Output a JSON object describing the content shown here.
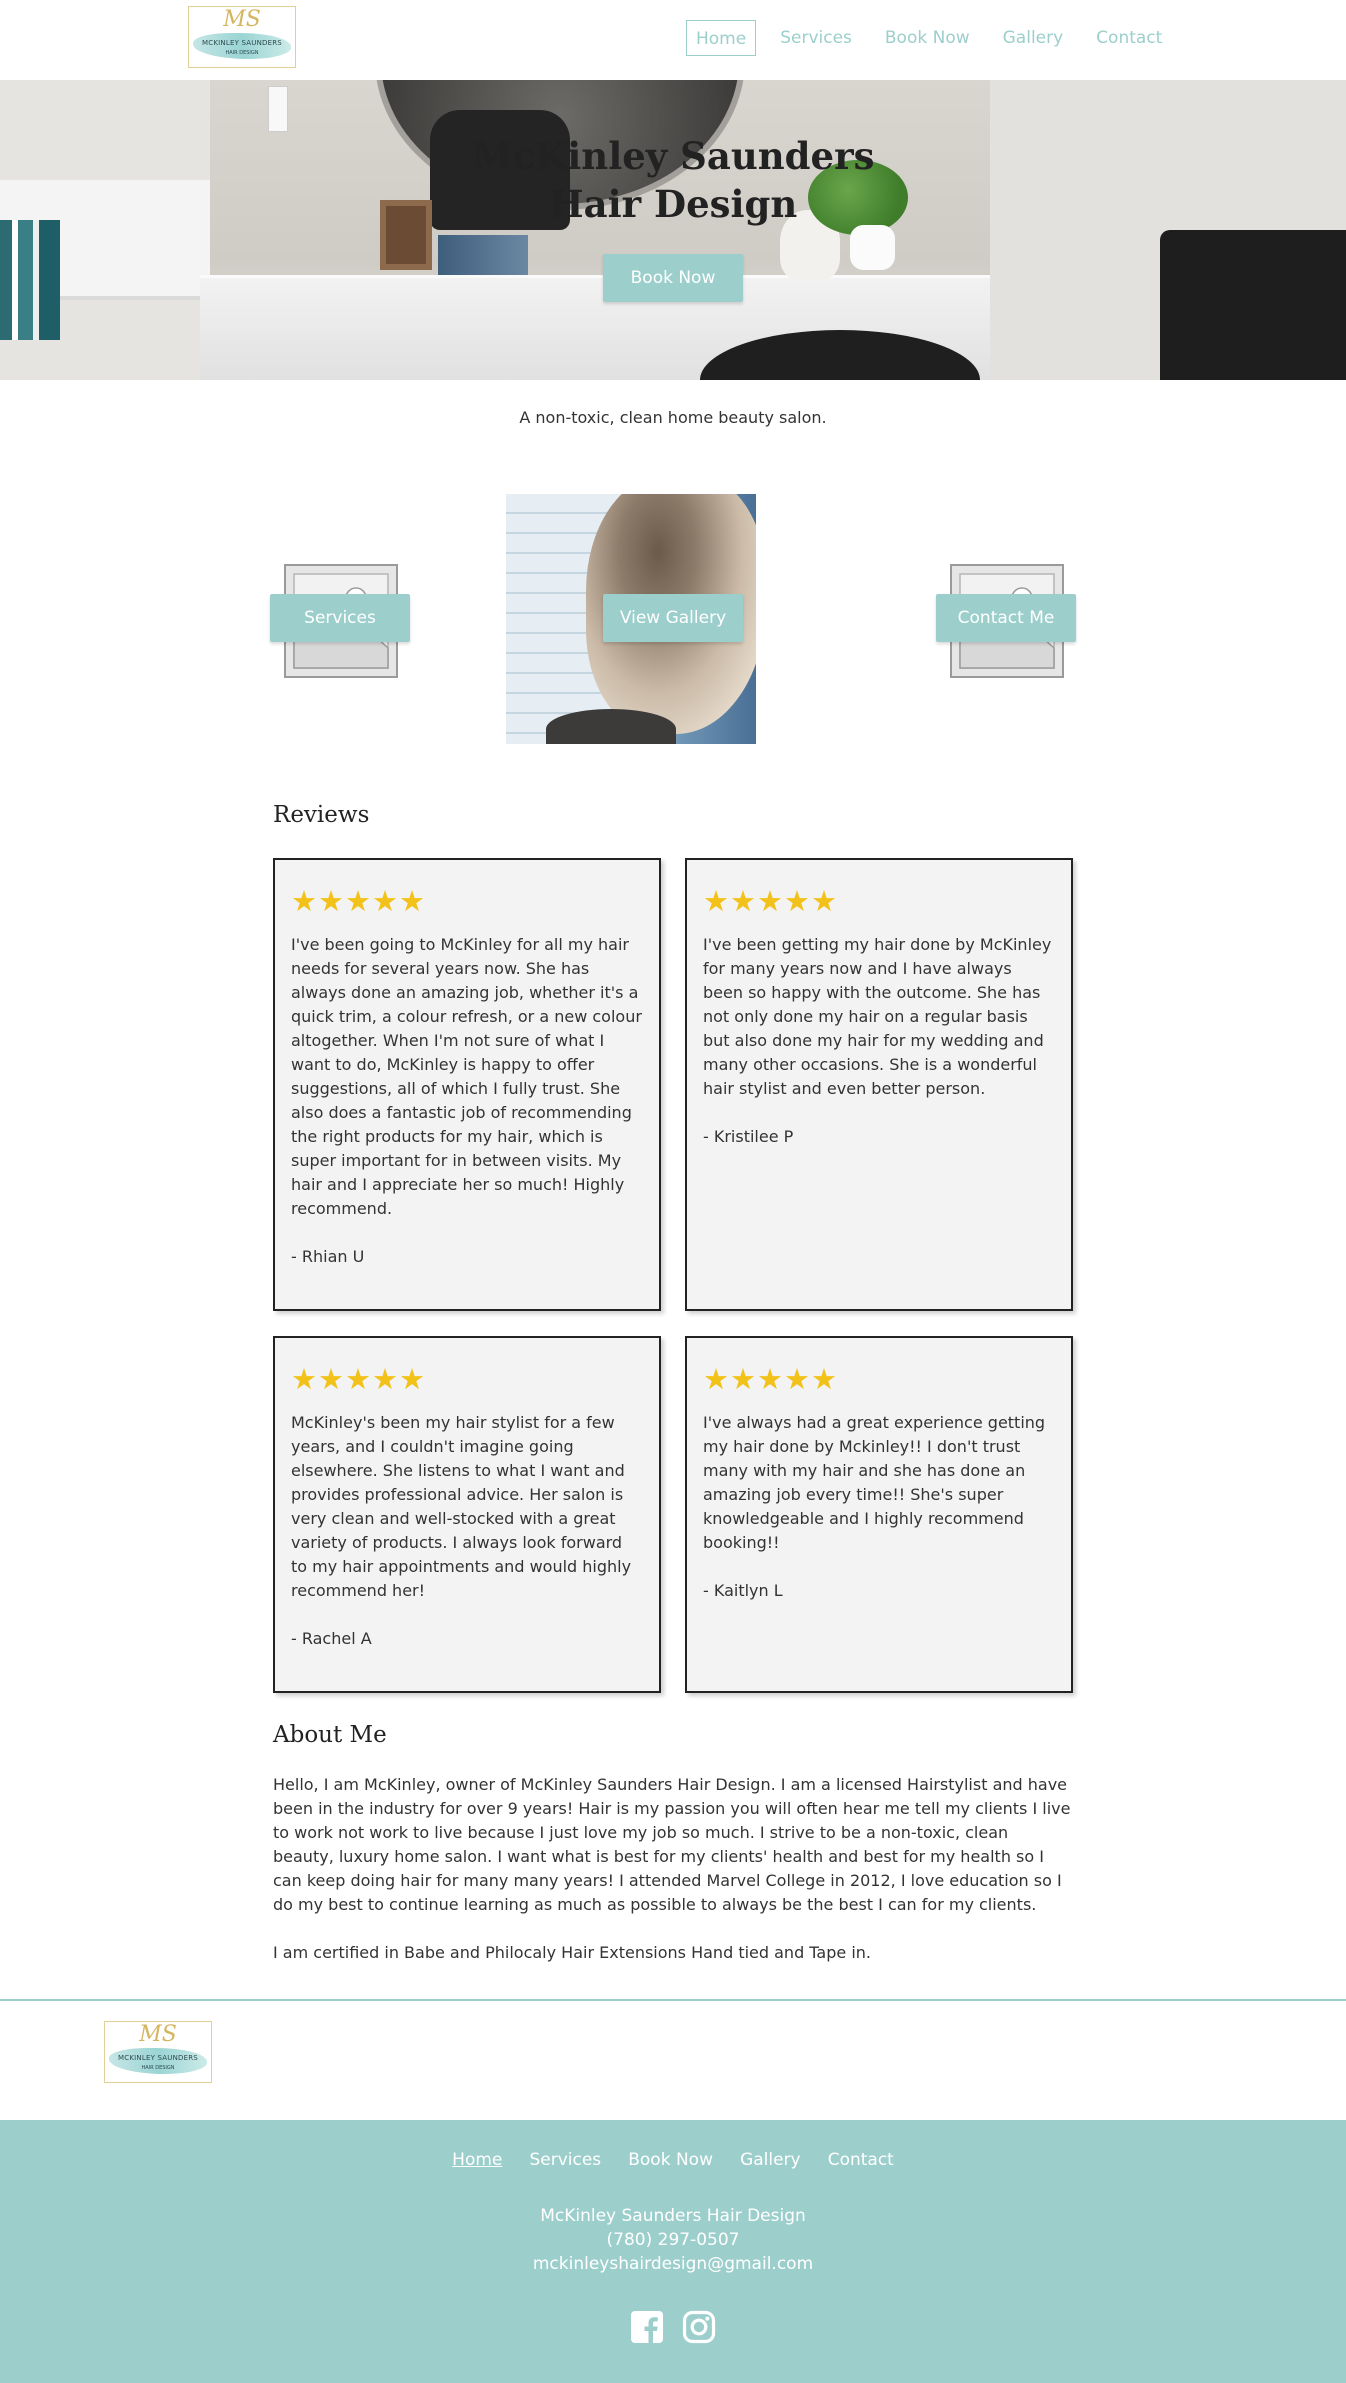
{
  "header": {
    "logo": {
      "monogram": "MS",
      "name": "MCKINLEY SAUNDERS",
      "subtitle": "HAIR DESIGN"
    },
    "nav": [
      {
        "label": "Home",
        "active": true
      },
      {
        "label": "Services",
        "active": false
      },
      {
        "label": "Book Now",
        "active": false
      },
      {
        "label": "Gallery",
        "active": false
      },
      {
        "label": "Contact",
        "active": false
      }
    ]
  },
  "hero": {
    "title_line1": "McKinley Saunders",
    "title_line2": "Hair Design",
    "button": "Book Now"
  },
  "tagline": "A non-toxic, clean home beauty salon.",
  "tiles": {
    "services": "Services",
    "gallery": "View Gallery",
    "contact": "Contact Me"
  },
  "reviews": {
    "heading": "Reviews",
    "stars": "★★★★★",
    "items": [
      {
        "text": "I've been going to McKinley for all my hair needs for several years now. She has always done an amazing job, whether it's a quick trim, a colour refresh, or a new colour altogether. When I'm not sure of what I want to do, McKinley is happy to offer suggestions, all of which I fully trust. She also does a fantastic job of recommending the right products for my hair, which is super important for in between visits. My hair and I appreciate her so much! Highly recommend.",
        "author": "- Rhian U"
      },
      {
        "text": "I've been getting my hair done by McKinley for many years now and I have always been so happy with the outcome. She has not only done my hair on a regular basis but also done my hair for my wedding and many other occasions. She is a wonderful hair stylist and even better person.",
        "author": "- Kristilee P"
      },
      {
        "text": "McKinley's been my hair stylist for a few years, and I couldn't imagine going elsewhere. She listens to what I want and provides professional advice. Her salon is very clean and well-stocked with a great variety of products. I always look forward to my hair appointments and would highly recommend her!",
        "author": "- Rachel A"
      },
      {
        "text": "I've always had a great experience getting my hair done by Mckinley!! I don't trust many with my hair and she has done an amazing job every time!! She's super knowledgeable and I highly recommend booking!!",
        "author": "- Kaitlyn L"
      }
    ]
  },
  "about": {
    "heading": "About Me",
    "paragraph1": "Hello, I am McKinley, owner of McKinley Saunders Hair Design. I am a licensed Hairstylist and have been in the industry for over 9 years! Hair is my passion you will often hear me tell my clients I live to work not work to live because I just love my job so much. I strive to be a non-toxic, clean beauty, luxury home salon. I want what is best for my clients' health and best for my health so I can keep doing hair for many many years! I attended Marvel College in 2012, I love education so I do my best to continue learning as much as possible to always be the best I can for my clients.",
    "paragraph2": "I am certified in Babe and Philocaly Hair Extensions Hand tied and Tape in."
  },
  "footer": {
    "nav": [
      {
        "label": "Home",
        "active": true
      },
      {
        "label": "Services",
        "active": false
      },
      {
        "label": "Book Now",
        "active": false
      },
      {
        "label": "Gallery",
        "active": false
      },
      {
        "label": "Contact",
        "active": false
      }
    ],
    "business_name": "McKinley Saunders Hair Design",
    "phone": "(780) 297-0507",
    "email": "mckinleyshairdesign@gmail.com",
    "social": [
      "facebook-icon",
      "instagram-icon"
    ]
  },
  "colors": {
    "accent": "#9ccfcc",
    "star": "#f2c21b",
    "card_bg": "#f3f3f3",
    "logo_gold": "#d4b560"
  }
}
